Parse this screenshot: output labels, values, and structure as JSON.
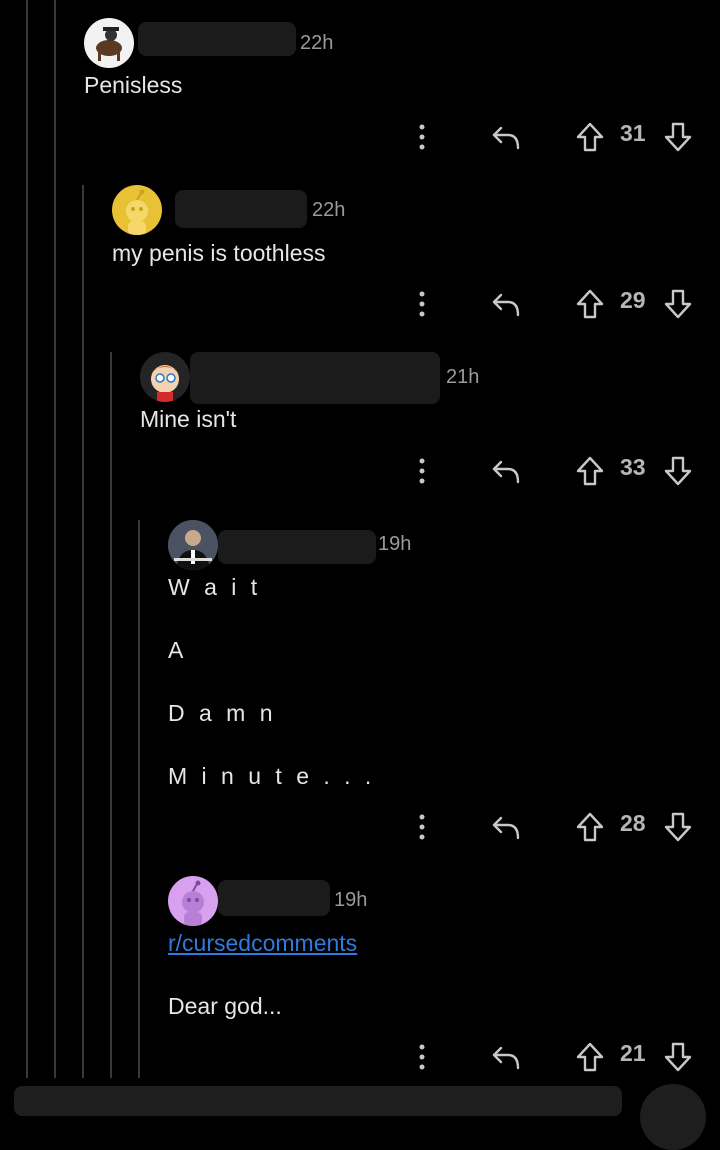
{
  "comments": [
    {
      "time": "22h",
      "body": [
        "Penisless"
      ],
      "score": "31"
    },
    {
      "time": "22h",
      "body": [
        "my penis is toothless"
      ],
      "score": "29"
    },
    {
      "time": "21h",
      "body": [
        "Mine isn't"
      ],
      "score": "33"
    },
    {
      "time": "19h",
      "body": [
        "W a i t",
        "A",
        "D a m n",
        "M i n u t e . . ."
      ],
      "score": "28"
    },
    {
      "time": "19h",
      "subreddit_link": "r/cursedcomments",
      "body": [
        "Dear god..."
      ],
      "score": "21"
    }
  ],
  "colors": {
    "background": "#000000",
    "link": "#2f7bdc",
    "thread_line": "#3a3a3c",
    "avatar_yellow": "#e8c234",
    "avatar_purple": "#d7a1f0"
  },
  "icons": {
    "more": "kebab-vertical-icon",
    "reply": "reply-arrow-icon",
    "upvote": "arrow-up-outline-icon",
    "downvote": "arrow-down-outline-icon"
  }
}
